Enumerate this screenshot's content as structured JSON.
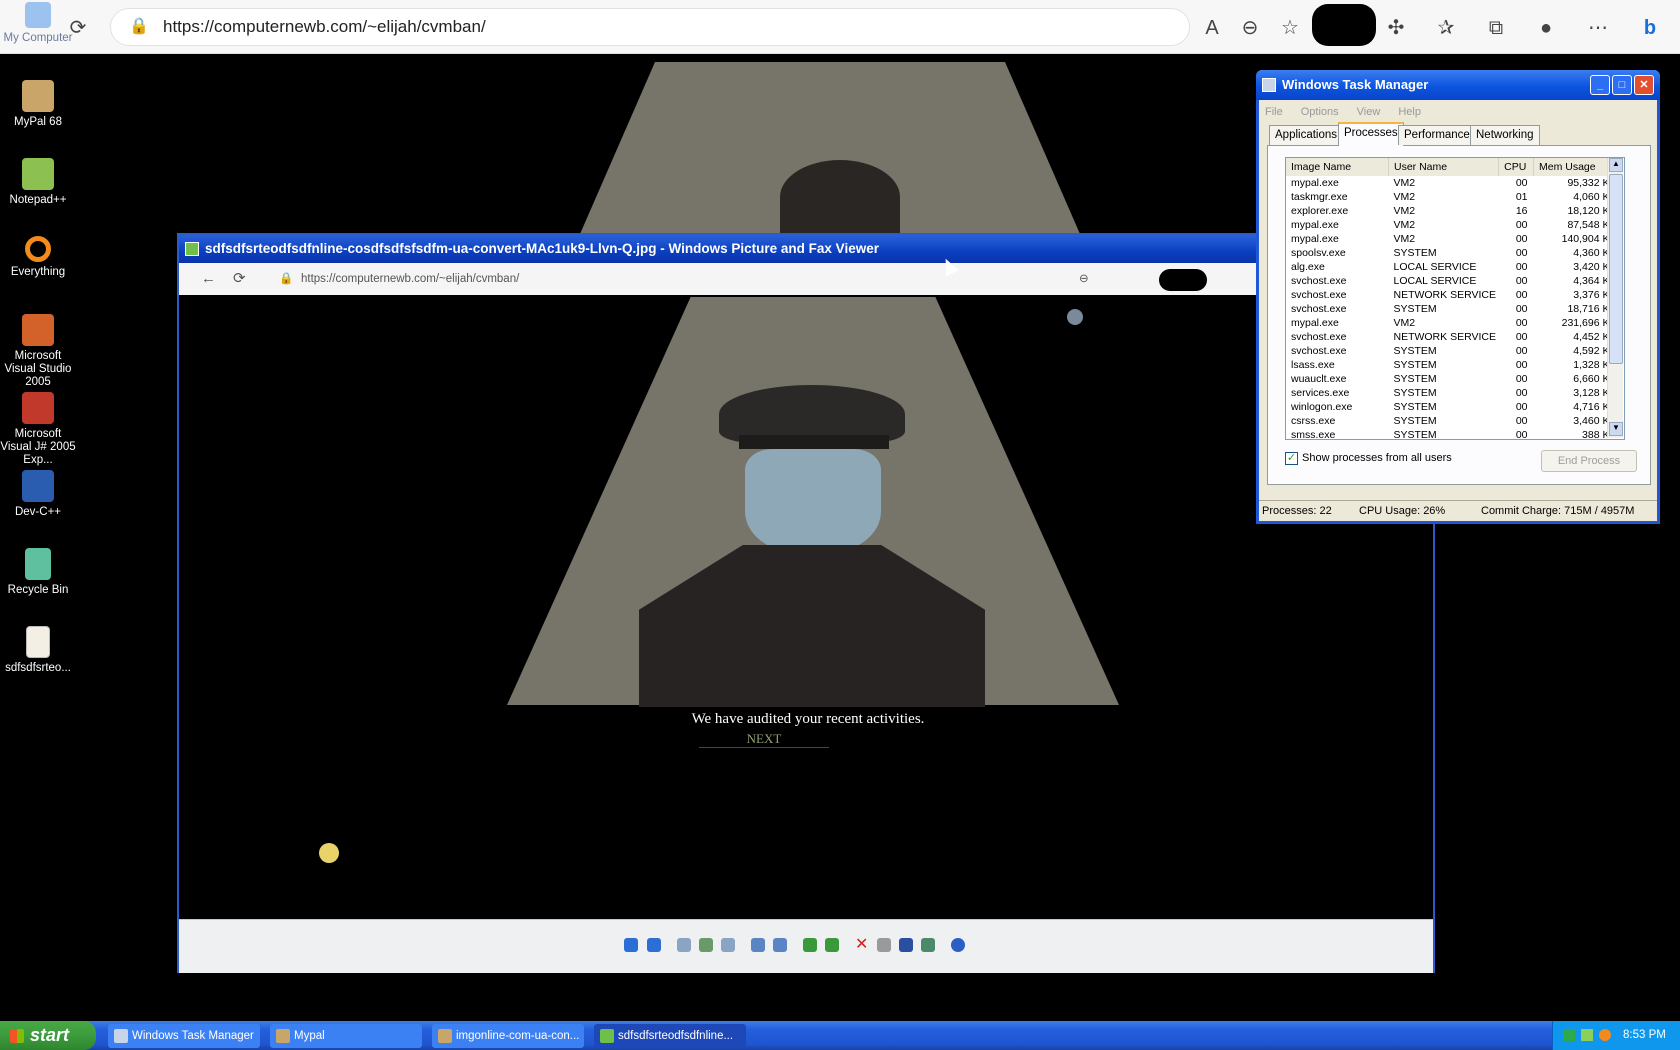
{
  "browser": {
    "url": "https://computernewb.com/~elijah/cvmban/"
  },
  "desktop": {
    "icons": [
      {
        "label": "My Computer"
      },
      {
        "label": "MyPal 68"
      },
      {
        "label": "Notepad++"
      },
      {
        "label": "Everything"
      },
      {
        "label": "Microsoft Visual Studio 2005"
      },
      {
        "label": "Microsoft Visual J# 2005 Exp..."
      },
      {
        "label": "Dev-C++"
      },
      {
        "label": "Recycle Bin"
      },
      {
        "label": "sdfsdfsrteo..."
      }
    ]
  },
  "viewer": {
    "title": "sdfsdfsrteodfsdfnline-cosdfsdfsfsdfm-ua-convert-MAc1uk9-Llvn-Q.jpg - Windows Picture and Fax Viewer",
    "url": "https://computernewb.com/~elijah/cvmban/",
    "caption": "We have audited your recent activities.",
    "next": "NEXT"
  },
  "taskmanager": {
    "title": "Windows Task Manager",
    "menu": [
      "File",
      "Options",
      "View",
      "Help"
    ],
    "tabs": [
      "Applications",
      "Processes",
      "Performance",
      "Networking"
    ],
    "active_tab": "Processes",
    "columns": [
      "Image Name",
      "User Name",
      "CPU",
      "Mem Usage"
    ],
    "rows": [
      [
        "mypal.exe",
        "VM2",
        "00",
        "95,332 K"
      ],
      [
        "taskmgr.exe",
        "VM2",
        "01",
        "4,060 K"
      ],
      [
        "explorer.exe",
        "VM2",
        "16",
        "18,120 K"
      ],
      [
        "mypal.exe",
        "VM2",
        "00",
        "87,548 K"
      ],
      [
        "mypal.exe",
        "VM2",
        "00",
        "140,904 K"
      ],
      [
        "spoolsv.exe",
        "SYSTEM",
        "00",
        "4,360 K"
      ],
      [
        "alg.exe",
        "LOCAL SERVICE",
        "00",
        "3,420 K"
      ],
      [
        "svchost.exe",
        "LOCAL SERVICE",
        "00",
        "4,364 K"
      ],
      [
        "svchost.exe",
        "NETWORK SERVICE",
        "00",
        "3,376 K"
      ],
      [
        "svchost.exe",
        "SYSTEM",
        "00",
        "18,716 K"
      ],
      [
        "mypal.exe",
        "VM2",
        "00",
        "231,696 K"
      ],
      [
        "svchost.exe",
        "NETWORK SERVICE",
        "00",
        "4,452 K"
      ],
      [
        "svchost.exe",
        "SYSTEM",
        "00",
        "4,592 K"
      ],
      [
        "lsass.exe",
        "SYSTEM",
        "00",
        "1,328 K"
      ],
      [
        "wuauclt.exe",
        "SYSTEM",
        "00",
        "6,660 K"
      ],
      [
        "services.exe",
        "SYSTEM",
        "00",
        "3,128 K"
      ],
      [
        "winlogon.exe",
        "SYSTEM",
        "00",
        "4,716 K"
      ],
      [
        "csrss.exe",
        "SYSTEM",
        "00",
        "3,460 K"
      ],
      [
        "smss.exe",
        "SYSTEM",
        "00",
        "388 K"
      ]
    ],
    "show_all_label": "Show processes from all users",
    "show_all_checked": true,
    "end_process": "End Process",
    "status": {
      "processes": "Processes: 22",
      "cpu": "CPU Usage: 26%",
      "commit": "Commit Charge: 715M / 4957M"
    }
  },
  "taskbar": {
    "start": "start",
    "buttons": [
      {
        "label": "Windows Task Manager",
        "active": false
      },
      {
        "label": "Mypal",
        "active": false
      },
      {
        "label": "imgonline-com-ua-con...",
        "active": false
      },
      {
        "label": "sdfsdfsrteodfsdfnline...",
        "active": true
      }
    ],
    "clock": "8:53 PM"
  }
}
